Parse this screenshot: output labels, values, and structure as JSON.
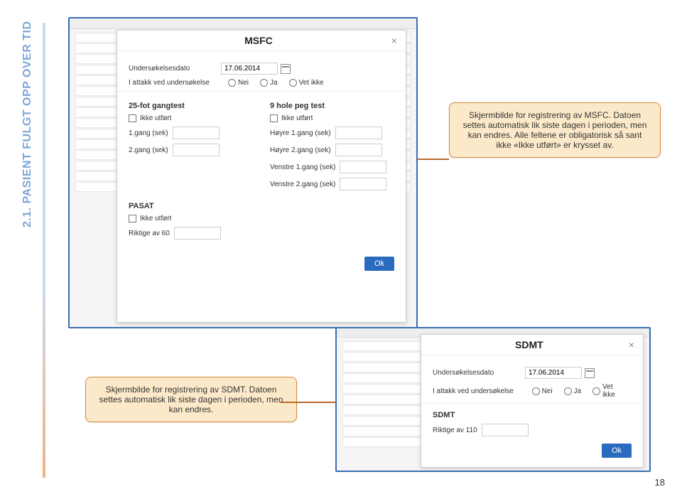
{
  "page": {
    "number": "18",
    "sidebar_label": "2.1. PASIENT FULGT OPP OVER TID"
  },
  "callouts": {
    "msfc": "Skjermbilde for registrering av MSFC. Datoen settes automatisk lik siste dagen i perioden, men kan endres. Alle feltene er obligatorisk så sant ikke «Ikke utført» er krysset av.",
    "sdmt": "Skjermbilde for registrering av SDMT. Datoen settes automatisk lik siste dagen i perioden, men kan endres."
  },
  "msfc": {
    "title": "MSFC",
    "exam_date_label": "Undersøkelsesdato",
    "exam_date_value": "17.06.2014",
    "attack_label": "I attakk ved undersøkelse",
    "radio_no": "Nei",
    "radio_yes": "Ja",
    "radio_unknown": "Vet ikke",
    "gang_h": "25-fot gangtest",
    "peg_h": "9 hole peg test",
    "not_done": "Ikke utført",
    "gang1": "1.gang (sek)",
    "gang2": "2.gang (sek)",
    "h1": "Høyre 1.gang (sek)",
    "h2": "Høyre 2.gang (sek)",
    "v1": "Venstre 1.gang (sek)",
    "v2": "Venstre 2.gang (sek)",
    "pasat_h": "PASAT",
    "pasat_field": "Riktige av 60",
    "ok": "Ok"
  },
  "sdmt": {
    "title": "SDMT",
    "exam_date_label": "Undersøkelsesdato",
    "exam_date_value": "17.06.2014",
    "attack_label": "I attakk ved undersøkelse",
    "radio_no": "Nei",
    "radio_yes": "Ja",
    "radio_unknown": "Vet ikke",
    "section_h": "SDMT",
    "field": "Riktige av 110",
    "ok": "Ok"
  }
}
